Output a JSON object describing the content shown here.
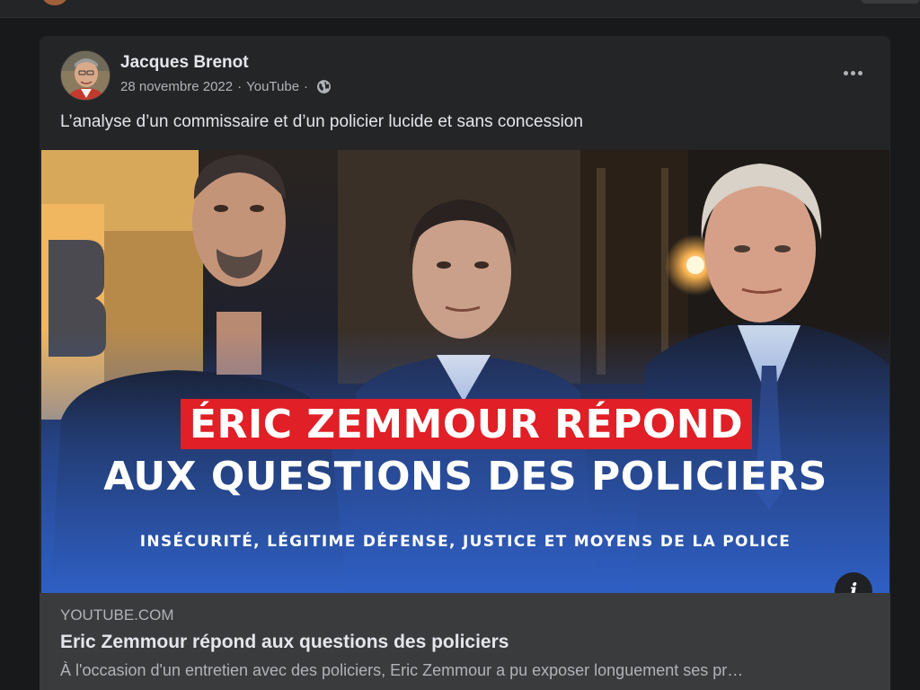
{
  "post": {
    "author": "Jacques Brenot",
    "date": "28 novembre 2022",
    "source": "YouTube",
    "separator": "·",
    "privacy_icon": "globe-icon",
    "more_icon": "more-options-icon",
    "text": "L’analyse d’un commissaire et d’un policier lucide et sans concession"
  },
  "thumbnail": {
    "headline_red": "ÉRIC ZEMMOUR RÉPOND",
    "headline_white": "AUX QUESTIONS DES POLICIERS",
    "subline": "INSÉCURITÉ, LÉGITIME DÉFENSE, JUSTICE ET MOYENS DE LA POLICE",
    "info_label": "i",
    "colors": {
      "banner_red": "#e01f26",
      "gradient_blue": "#2f5fc4"
    }
  },
  "link": {
    "domain": "YOUTUBE.COM",
    "title": "Eric Zemmour répond aux questions des policiers",
    "description": "À l'occasion d'un entretien avec des policiers, Eric Zemmour a pu exposer longuement ses pr…"
  },
  "theme": {
    "background": "#18191a",
    "card": "#242526",
    "preview": "#3a3b3c",
    "text_primary": "#e4e6eb",
    "text_secondary": "#b0b3b8"
  }
}
